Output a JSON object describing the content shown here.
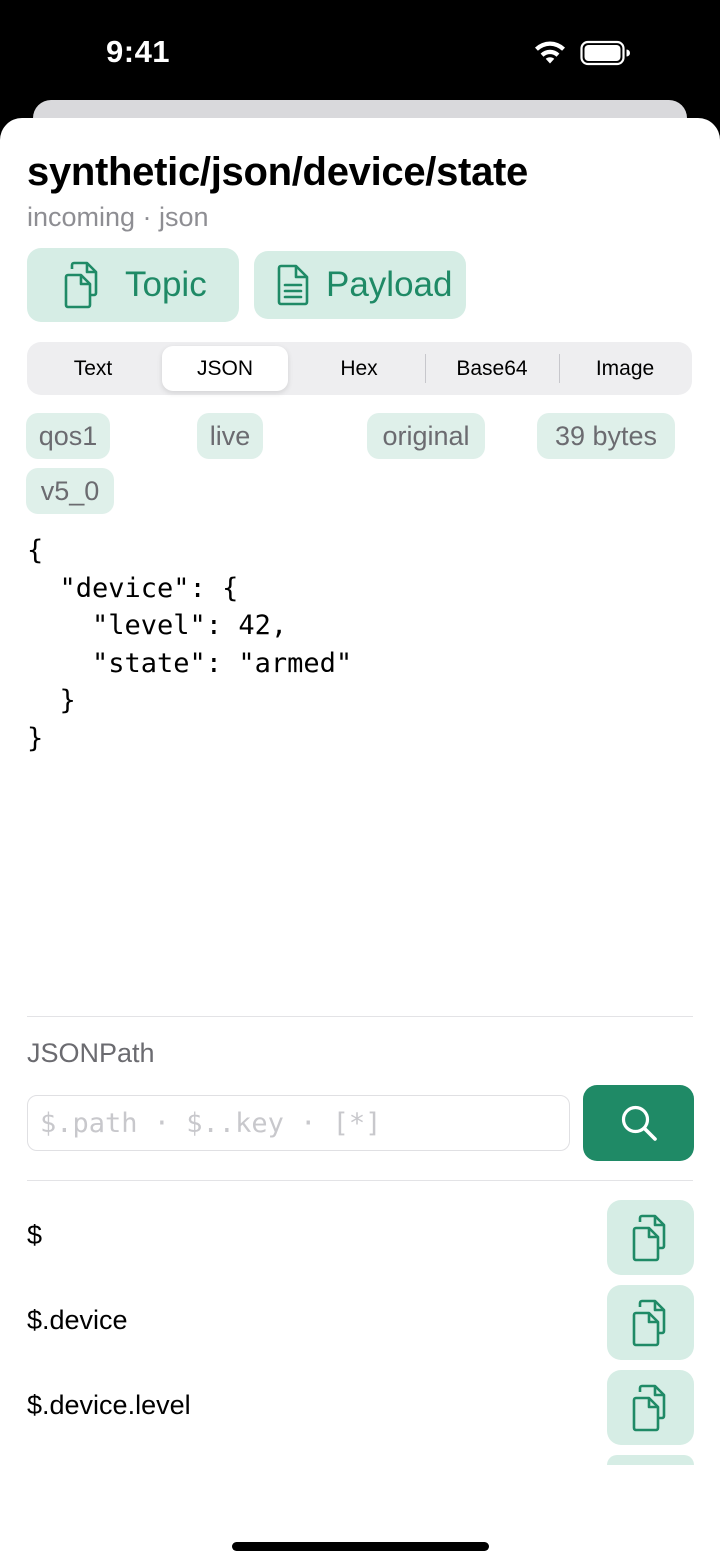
{
  "status": {
    "time": "9:41"
  },
  "header": {
    "title": "synthetic/json/device/state",
    "subtitle": "incoming · json"
  },
  "actions": {
    "topic_label": "Topic",
    "payload_label": "Payload"
  },
  "tabs": [
    {
      "label": "Text",
      "active": false
    },
    {
      "label": "JSON",
      "active": true
    },
    {
      "label": "Hex",
      "active": false
    },
    {
      "label": "Base64",
      "active": false
    },
    {
      "label": "Image",
      "active": false
    }
  ],
  "chips": [
    "qos1",
    "live",
    "original",
    "39 bytes",
    "v5_0"
  ],
  "payload_code": "{\n  \"device\": {\n    \"level\": 42,\n    \"state\": \"armed\"\n  }\n}",
  "jsonpath": {
    "label": "JSONPath",
    "value": "",
    "placeholder": "$.path · $..key · [*]"
  },
  "paths": [
    "$",
    "$.device",
    "$.device.level"
  ],
  "colors": {
    "accent": "#1f8a66",
    "accent_light": "#d6ede5",
    "chip_bg": "#dff0ea"
  }
}
